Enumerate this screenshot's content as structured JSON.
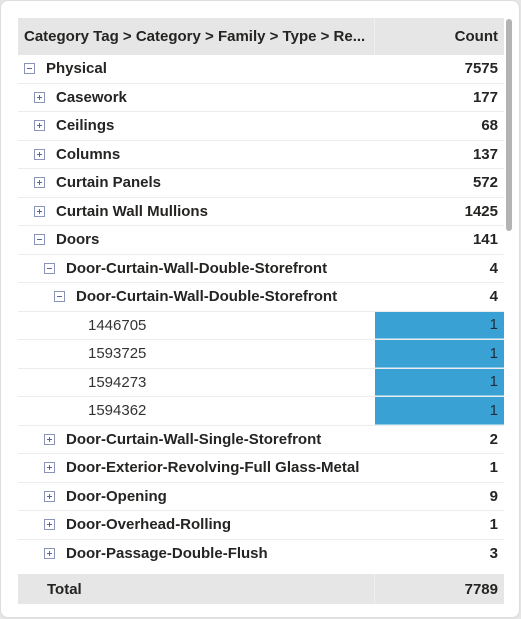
{
  "header": {
    "column1": "Category Tag > Category > Family > Type > Re...",
    "column2": "Count"
  },
  "rows": [
    {
      "label": "Physical",
      "count": "7575",
      "level": 0,
      "toggle": "collapse"
    },
    {
      "label": "Casework",
      "count": "177",
      "level": 1,
      "toggle": "expand"
    },
    {
      "label": "Ceilings",
      "count": "68",
      "level": 1,
      "toggle": "expand"
    },
    {
      "label": "Columns",
      "count": "137",
      "level": 1,
      "toggle": "expand"
    },
    {
      "label": "Curtain Panels",
      "count": "572",
      "level": 1,
      "toggle": "expand"
    },
    {
      "label": "Curtain Wall Mullions",
      "count": "1425",
      "level": 1,
      "toggle": "expand"
    },
    {
      "label": "Doors",
      "count": "141",
      "level": 1,
      "toggle": "collapse"
    },
    {
      "label": "Door-Curtain-Wall-Double-Storefront",
      "count": "4",
      "level": 2,
      "toggle": "collapse"
    },
    {
      "label": "Door-Curtain-Wall-Double-Storefront",
      "count": "4",
      "level": 3,
      "toggle": "collapse"
    },
    {
      "label": "1446705",
      "count": "1",
      "level": 4,
      "toggle": "none"
    },
    {
      "label": "1593725",
      "count": "1",
      "level": 4,
      "toggle": "none"
    },
    {
      "label": "1594273",
      "count": "1",
      "level": 4,
      "toggle": "none"
    },
    {
      "label": "1594362",
      "count": "1",
      "level": 4,
      "toggle": "none"
    },
    {
      "label": "Door-Curtain-Wall-Single-Storefront",
      "count": "2",
      "level": 2,
      "toggle": "expand"
    },
    {
      "label": "Door-Exterior-Revolving-Full Glass-Metal",
      "count": "1",
      "level": 2,
      "toggle": "expand"
    },
    {
      "label": "Door-Opening",
      "count": "9",
      "level": 2,
      "toggle": "expand"
    },
    {
      "label": "Door-Overhead-Rolling",
      "count": "1",
      "level": 2,
      "toggle": "expand"
    },
    {
      "label": "Door-Passage-Double-Flush",
      "count": "3",
      "level": 2,
      "toggle": "expand"
    }
  ],
  "total": {
    "label": "Total",
    "count": "7789"
  },
  "colors": {
    "highlight": "#3aa1d4",
    "header_bg": "#e6e6e6"
  }
}
